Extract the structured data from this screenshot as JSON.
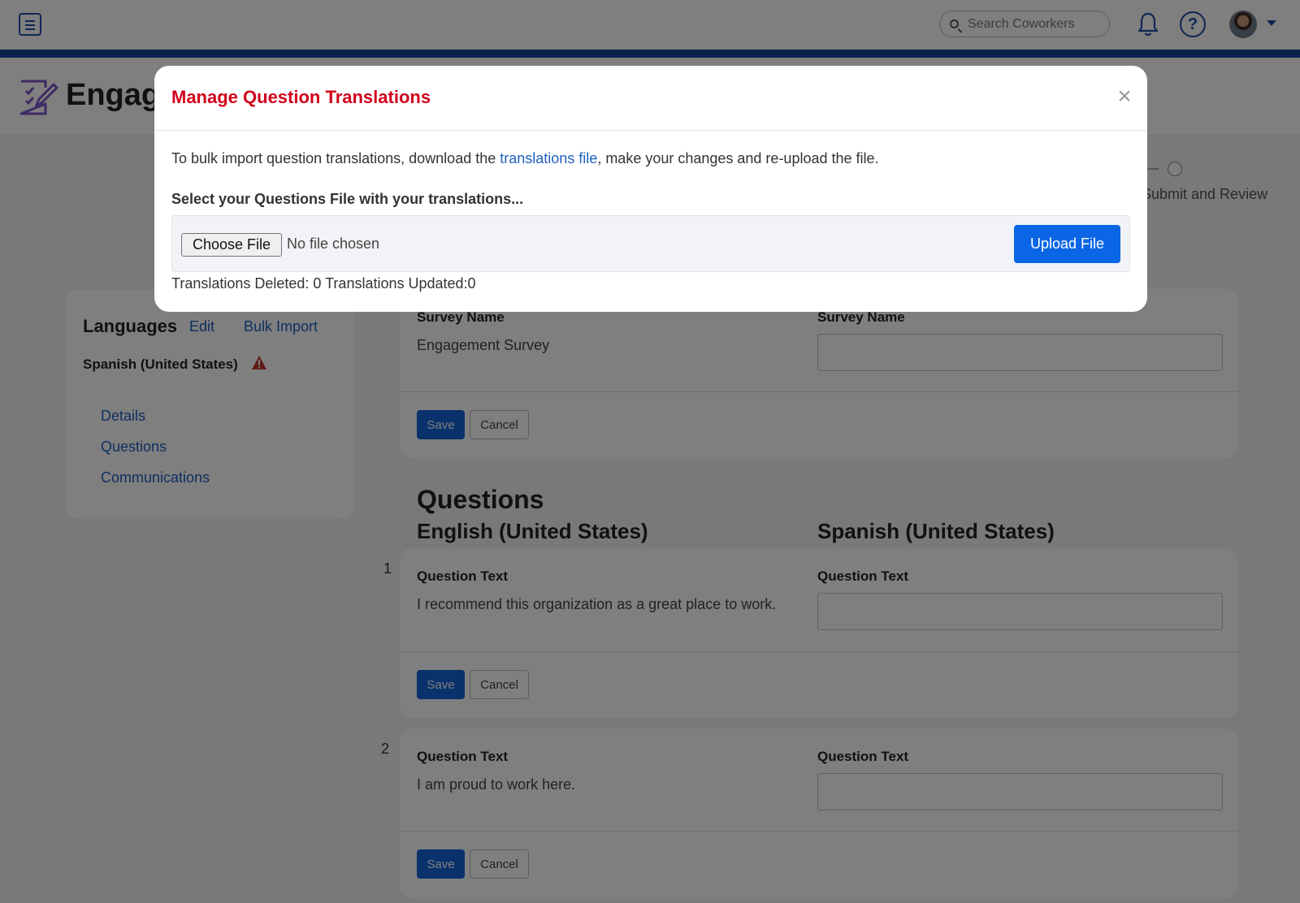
{
  "topbar": {
    "search_placeholder": "Search Coworkers"
  },
  "app": {
    "title": "Engagement Surveys"
  },
  "stepper": {
    "visible_step_label": "Submit and Review"
  },
  "languages": {
    "title": "Languages",
    "edit_label": "Edit",
    "bulk_import_label": "Bulk Import",
    "current_language": "Spanish (United States)",
    "links": [
      "Details",
      "Questions",
      "Communications"
    ]
  },
  "survey_name_card": {
    "source_label": "Survey Name",
    "source_value": "Engagement Survey",
    "target_label": "Survey Name",
    "target_value": "",
    "save_label": "Save",
    "cancel_label": "Cancel"
  },
  "questions": {
    "section_title": "Questions",
    "source_language": "English (United States)",
    "target_language": "Spanish (United States)",
    "items": [
      {
        "number": "1",
        "source_label": "Question Text",
        "source_value": "I recommend this organization as a great place to work.",
        "target_label": "Question Text",
        "target_value": "",
        "save_label": "Save",
        "cancel_label": "Cancel"
      },
      {
        "number": "2",
        "source_label": "Question Text",
        "source_value": "I am proud to work here.",
        "target_label": "Question Text",
        "target_value": "",
        "save_label": "Save",
        "cancel_label": "Cancel"
      }
    ]
  },
  "modal": {
    "title": "Manage Question Translations",
    "close_glyph": "×",
    "desc_before": "To bulk import question translations, download the ",
    "desc_link": "translations file",
    "desc_after": ", make your changes and re-upload the file.",
    "select_label": "Select your Questions File with your translations...",
    "choose_file_label": "Choose File",
    "no_file_label": "No file chosen",
    "upload_label": "Upload File",
    "status": "Translations Deleted: 0 Translations Updated:0"
  },
  "colors": {
    "brand_blue": "#12479c",
    "link_blue": "#1f5fbf",
    "primary_button": "#0a66e4",
    "modal_title_red": "#d0021b",
    "warning_red": "#c0392b"
  },
  "icons": [
    "menu-icon",
    "search-icon",
    "bell-icon",
    "help-icon",
    "avatar",
    "chevron-down-icon",
    "survey-app-icon",
    "warning-icon",
    "close-icon"
  ]
}
